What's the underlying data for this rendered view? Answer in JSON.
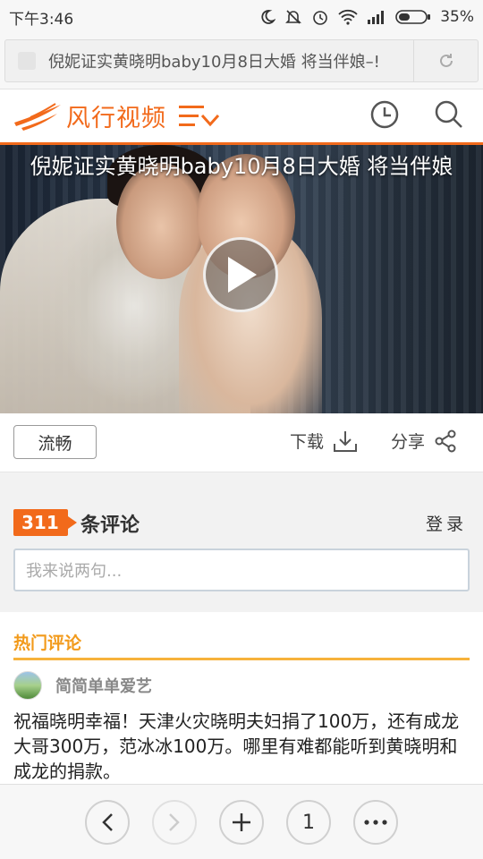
{
  "status_bar": {
    "time": "下午3:46",
    "battery": "35%"
  },
  "browser": {
    "url_text": "倪妮证实黄晓明baby10月8日大婚 将当伴娘–!"
  },
  "site": {
    "logo_text": "风行视频"
  },
  "video": {
    "title": "倪妮证实黄晓明baby10月8日大婚 将当伴娘"
  },
  "controls": {
    "quality_label": "流畅",
    "download_label": "下载",
    "share_label": "分享"
  },
  "comments": {
    "count": "311",
    "count_label": "条评论",
    "login_label": "登录",
    "input_placeholder": "我来说两句..."
  },
  "hot_comments": {
    "section_title": "热门评论",
    "items": [
      {
        "username": "简简单单爱艺",
        "text": "祝福晓明幸福！天津火灾晓明夫妇捐了100万，还有成龙大哥300万，范冰冰100万。哪里有难都能听到黄晓明和成龙的捐款。"
      }
    ]
  },
  "bottom_nav": {
    "tabs_count": "1"
  },
  "colors": {
    "brand_orange": "#f26a1b",
    "hot_title": "#f29a1b"
  }
}
